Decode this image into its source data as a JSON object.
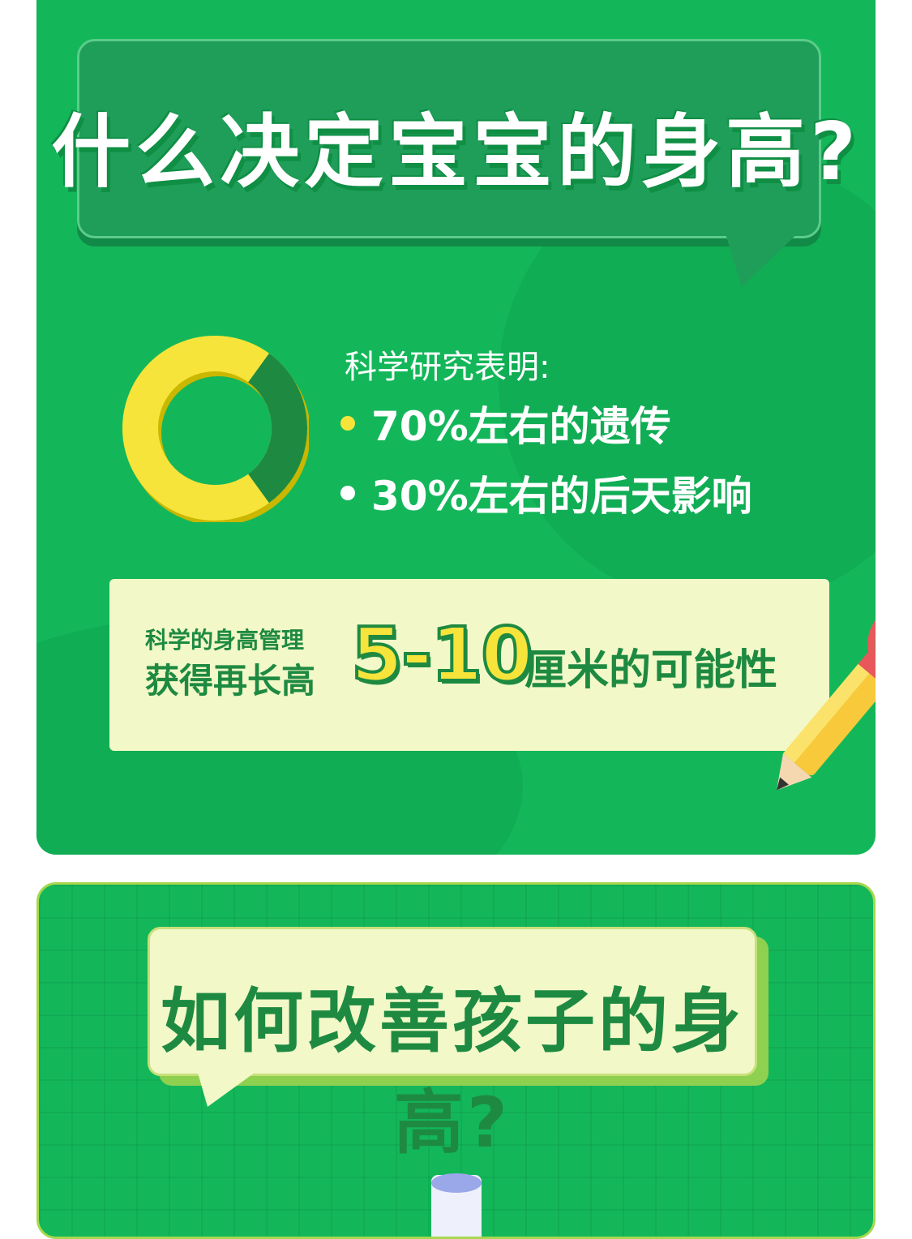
{
  "section1": {
    "title": "什么决定宝宝的身高?",
    "research_intro": "科学研究表明:",
    "bullets": [
      {
        "text": "70%左右的遗传",
        "dot_color": "#f7e43b"
      },
      {
        "text": "30%左右的后天影响",
        "dot_color": "#ffffff"
      }
    ],
    "donut": {
      "genetic_percent": 70,
      "acquired_percent": 30,
      "colors": {
        "genetic": "#f7e43b",
        "acquired": "#1e8a41"
      }
    },
    "management": {
      "line1": "科学的身高管理",
      "line2": "获得再长高",
      "highlight": "5-10",
      "suffix": "厘米的可能性"
    }
  },
  "section2": {
    "title": "如何改善孩子的身高?"
  },
  "colors": {
    "primary_green": "#13b75a",
    "dark_green": "#1e8a41",
    "yellow": "#f7e43b",
    "cream": "#f2f8c8"
  },
  "icons": [
    "pencil-icon",
    "dna-icon",
    "bottle-icon"
  ]
}
